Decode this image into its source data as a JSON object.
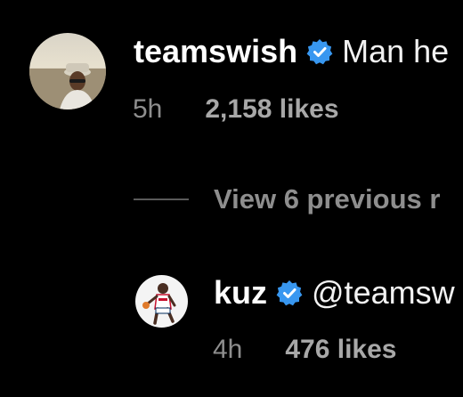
{
  "comments": [
    {
      "username": "teamswish",
      "verified": true,
      "text": "Man he",
      "time": "5h",
      "likes": "2,158 likes",
      "avatar": "beach-portrait"
    },
    {
      "username": "kuz",
      "verified": true,
      "text": "@teamsw",
      "time": "4h",
      "likes": "476 likes",
      "avatar": "basketball-player"
    }
  ],
  "replies": {
    "link_text": "View 6 previous r"
  },
  "colors": {
    "background": "#000000",
    "primary_text": "#ffffff",
    "secondary_text": "#8e8e8e",
    "verified_badge": "#3897f0",
    "divider": "#5a5a5a"
  }
}
